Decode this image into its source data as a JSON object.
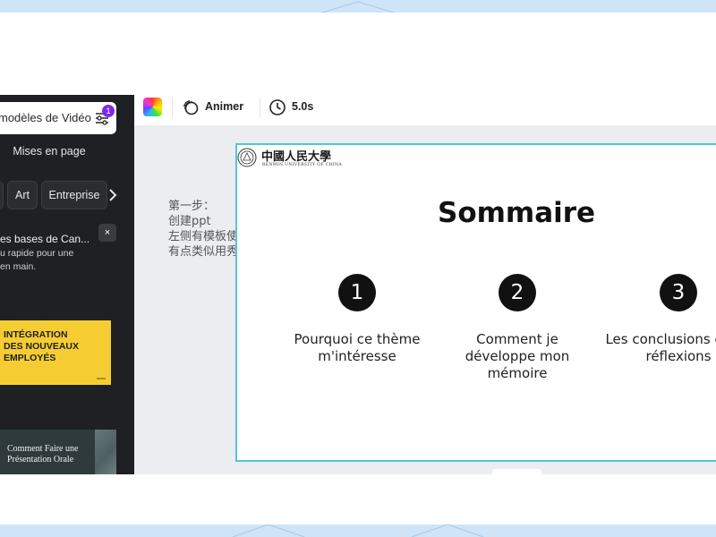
{
  "sidebar": {
    "search_placeholder": "modèles de Vidéo",
    "filter_badge": "1",
    "section_title": "Mises en page",
    "chips": [
      "",
      "Art",
      "Entreprise"
    ],
    "tip_title": "es bases de Can...",
    "tip_close": "×",
    "tip_text": [
      "u rapide pour une",
      "en main."
    ],
    "template_1_lines": [
      "INTÉGRATION",
      "DES NOUVEAUX",
      "EMPLOYÉS"
    ],
    "template_2_lines": [
      "Comment Faire une",
      "Présentation Orale"
    ]
  },
  "toolbar": {
    "color_icon": "color-palette-icon",
    "animate_label": "Animer",
    "duration_label": "5.0s"
  },
  "note": {
    "lines": [
      "第一步：",
      "创建ppt",
      "左侧有模板使用",
      "有点类似用秀米做公众号"
    ]
  },
  "slide": {
    "logo_cn": "中國人民大學",
    "logo_en": "RENMIN UNIVERSITY OF CHINA",
    "title": "Sommaire",
    "items": [
      {
        "number": "1",
        "text": "Pourquoi ce thème m'intéresse"
      },
      {
        "number": "2",
        "text": "Comment je développe mon mémoire"
      },
      {
        "number": "3",
        "text": "Les conclusions et les réflexions"
      }
    ]
  },
  "colors": {
    "frame": "#cfe4f7",
    "sidebar_bg": "#1f2023",
    "slide_border": "#54c6d4",
    "canvas_bg": "#ebedf1",
    "yellow_template": "#f5cd32",
    "badge": "#7d2ae8"
  }
}
